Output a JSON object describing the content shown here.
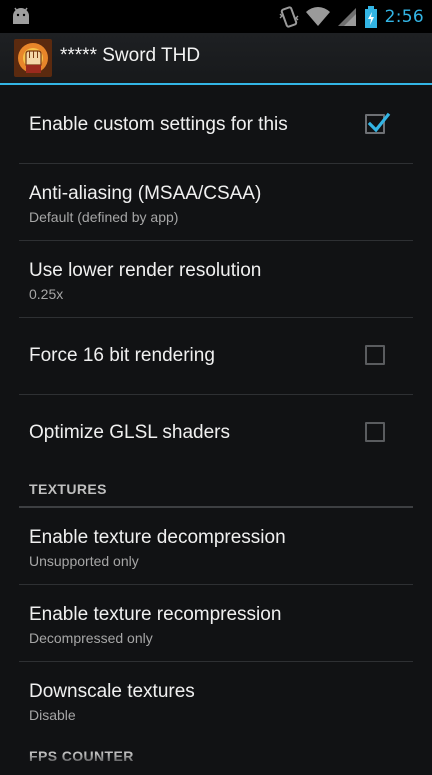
{
  "status_bar": {
    "time": "2:56",
    "icons": [
      "android-icon",
      "vibrate-icon",
      "wifi-icon",
      "signal-icon",
      "battery-charging-icon"
    ],
    "accent_color": "#33b5e5"
  },
  "action_bar": {
    "title": "***** Sword THD",
    "app_icon": "fist-app-icon"
  },
  "settings": {
    "enable_custom": {
      "title": "Enable custom settings for this",
      "checked": true
    },
    "anti_aliasing": {
      "title": "Anti-aliasing (MSAA/CSAA)",
      "summary": "Default (defined by app)"
    },
    "lower_resolution": {
      "title": "Use lower render resolution",
      "summary": "0.25x"
    },
    "force_16bit": {
      "title": "Force 16 bit rendering",
      "checked": false
    },
    "optimize_glsl": {
      "title": "Optimize GLSL shaders",
      "checked": false
    }
  },
  "textures": {
    "header": "TEXTURES",
    "decompression": {
      "title": "Enable texture decompression",
      "summary": "Unsupported only"
    },
    "recompression": {
      "title": "Enable texture recompression",
      "summary": "Decompressed only"
    },
    "downscale": {
      "title": "Downscale textures",
      "summary": "Disable"
    }
  },
  "fps": {
    "header": "FPS COUNTER"
  }
}
